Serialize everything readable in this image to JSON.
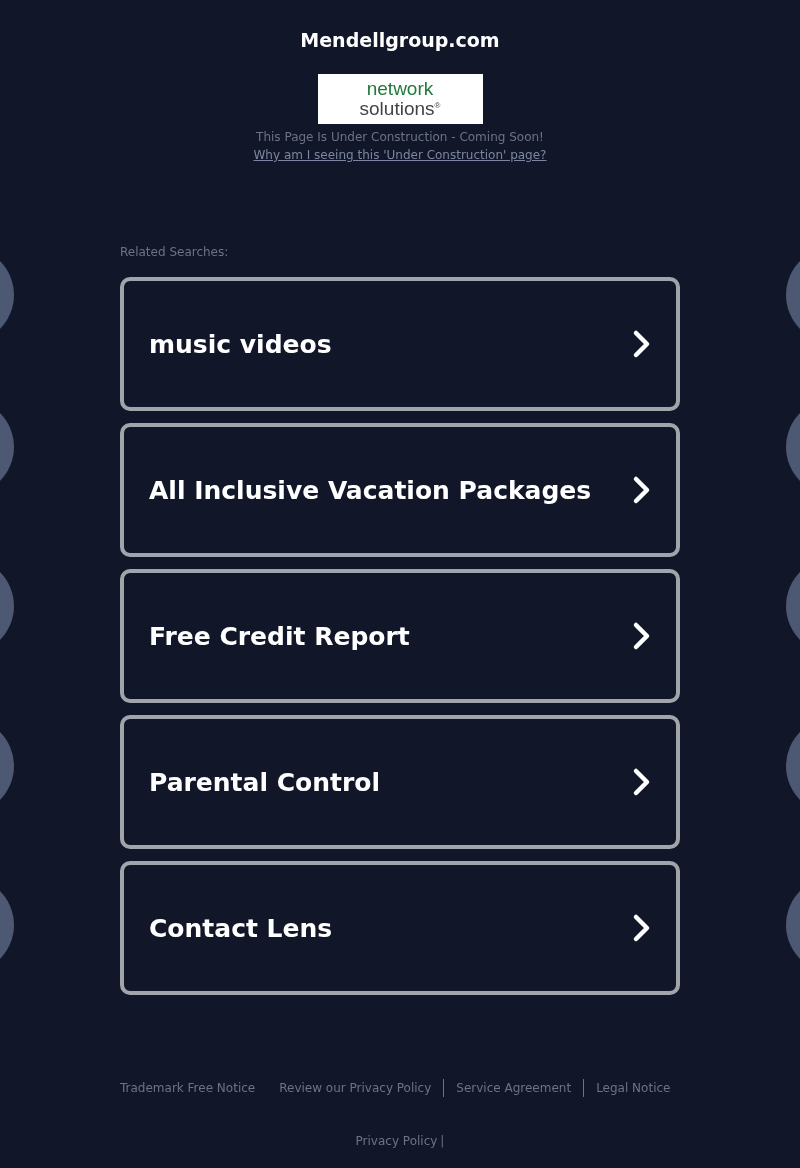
{
  "title": "Mendellgroup.com",
  "logo": {
    "line1": "network",
    "line2": "solutions",
    "mark": "®"
  },
  "notice": "This Page Is Under Construction - Coming Soon!",
  "notice_link": "Why am I seeing this 'Under Construction' page?",
  "related_label": "Related Searches:",
  "searches": [
    {
      "label": "music videos"
    },
    {
      "label": "All Inclusive Vacation Packages"
    },
    {
      "label": "Free Credit Report"
    },
    {
      "label": "Parental Control"
    },
    {
      "label": "Contact Lens"
    }
  ],
  "footer_links": [
    {
      "label": "Trademark Free Notice",
      "divider": false
    },
    {
      "label": "Review our Privacy Policy",
      "divider": true
    },
    {
      "label": "Service Agreement",
      "divider": true
    },
    {
      "label": "Legal Notice",
      "divider": false
    }
  ],
  "bottom_link": "Privacy Policy",
  "bottom_separator": "|"
}
